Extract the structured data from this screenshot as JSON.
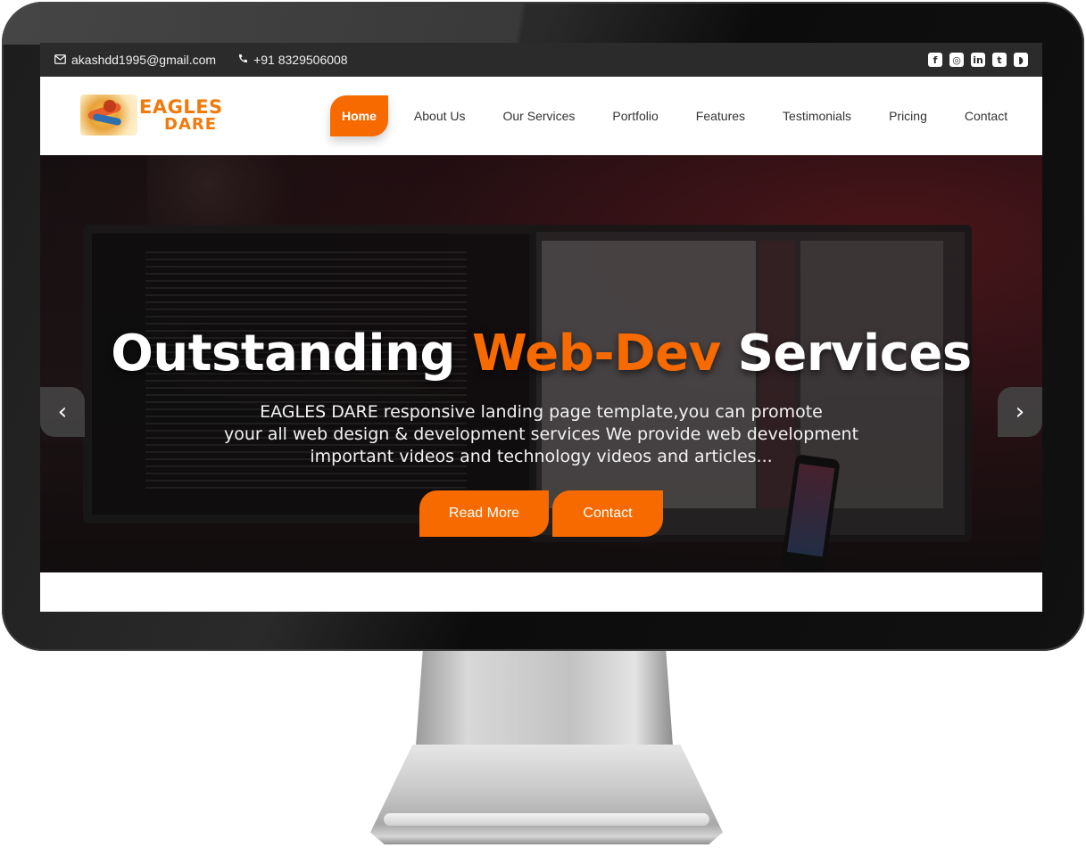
{
  "topbar": {
    "email": "akashdd1995@gmail.com",
    "phone": "+91 8329506008",
    "social": [
      {
        "icon": "facebook-icon",
        "glyph": "f"
      },
      {
        "icon": "instagram-icon",
        "glyph": "◎"
      },
      {
        "icon": "linkedin-icon",
        "glyph": "in"
      },
      {
        "icon": "twitter-icon",
        "glyph": "t"
      },
      {
        "icon": "rss-icon",
        "glyph": "◗"
      }
    ]
  },
  "logo": {
    "line1": "EAGLES",
    "line2": "DARE"
  },
  "nav": {
    "items": [
      "Home",
      "About Us",
      "Our Services",
      "Portfolio",
      "Features",
      "Testimonials",
      "Pricing",
      "Contact"
    ],
    "active_index": 0
  },
  "hero": {
    "title_pre": "Outstanding ",
    "title_accent": "Web-Dev",
    "title_post": " Services",
    "description": [
      "EAGLES DARE responsive landing page template,you can promote",
      "your all web design & development services We provide web development",
      "important videos and technology videos and articles..."
    ],
    "read_more": "Read More",
    "contact": "Contact",
    "prev_arrow": "‹",
    "next_arrow": "›"
  },
  "colors": {
    "accent": "#f66a00",
    "topbar_bg": "#2b2b2b"
  }
}
